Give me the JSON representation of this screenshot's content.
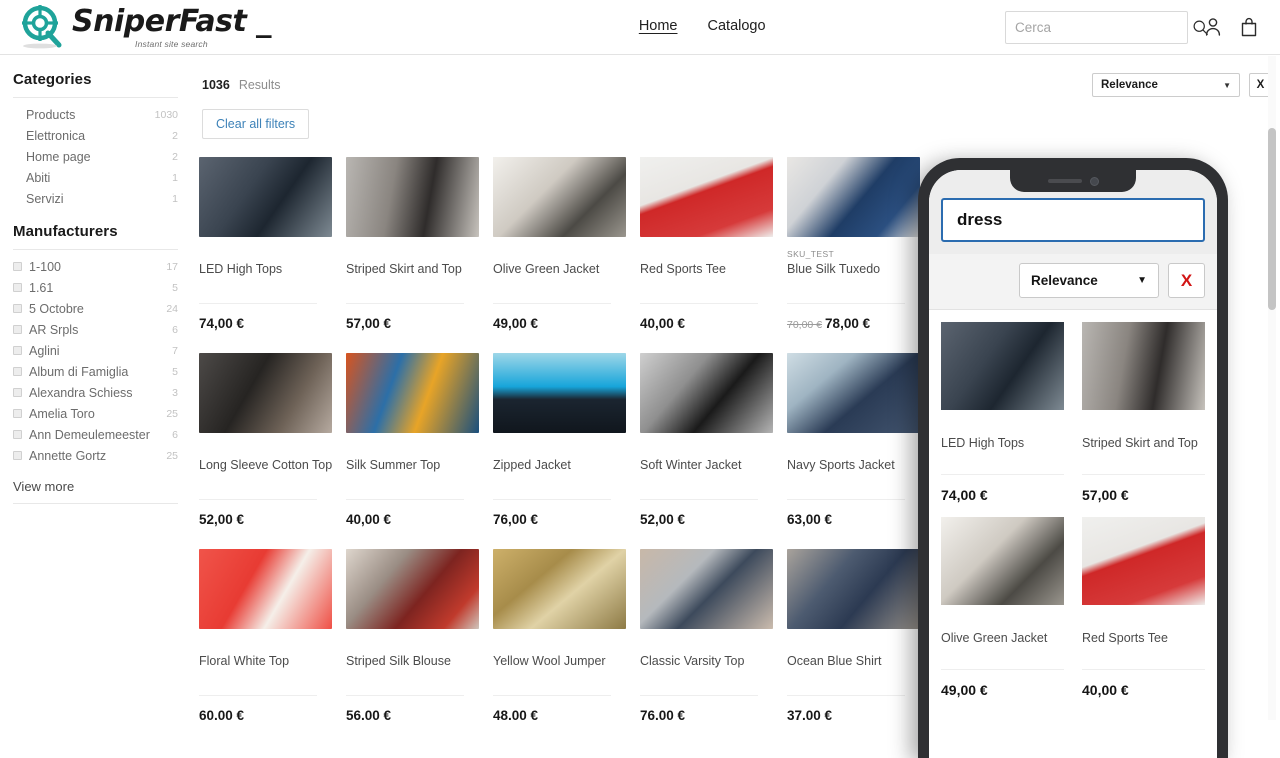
{
  "brand": {
    "name": "SniperFast _",
    "tagline": "Instant site search",
    "logo_color": "#1fa39a"
  },
  "header": {
    "nav": [
      {
        "label": "Home",
        "active": true
      },
      {
        "label": "Catalogo",
        "active": false
      }
    ],
    "search": {
      "value": "",
      "placeholder": "Cerca"
    },
    "icons": [
      "search-icon",
      "account-icon",
      "cart-icon"
    ]
  },
  "sidebar": {
    "categories_title": "Categories",
    "categories": [
      {
        "label": "Products",
        "count": "1030"
      },
      {
        "label": "Elettronica",
        "count": "2"
      },
      {
        "label": "Home page",
        "count": "2"
      },
      {
        "label": "Abiti",
        "count": "1"
      },
      {
        "label": "Servizi",
        "count": "1"
      }
    ],
    "manufacturers_title": "Manufacturers",
    "manufacturers": [
      {
        "label": "1-100",
        "count": "17"
      },
      {
        "label": "1.61",
        "count": "5"
      },
      {
        "label": "5 Octobre",
        "count": "24"
      },
      {
        "label": "AR Srpls",
        "count": "6"
      },
      {
        "label": "Aglini",
        "count": "7"
      },
      {
        "label": "Album di Famiglia",
        "count": "5"
      },
      {
        "label": "Alexandra Schiess",
        "count": "3"
      },
      {
        "label": "Amelia Toro",
        "count": "25"
      },
      {
        "label": "Ann Demeulemeester",
        "count": "6"
      },
      {
        "label": "Annette Gortz",
        "count": "25"
      }
    ],
    "view_more": "View more"
  },
  "main": {
    "results_count": "1036",
    "results_label": "Results",
    "clear_filters": "Clear all filters",
    "sort_value": "Relevance",
    "close_label": "X",
    "products": [
      {
        "sku": "",
        "name": "LED High Tops",
        "price": "74,00 €",
        "old_price": "",
        "art": "art-shoes"
      },
      {
        "sku": "",
        "name": "Striped Skirt and Top",
        "price": "57,00 €",
        "old_price": "",
        "art": "art-skirt"
      },
      {
        "sku": "",
        "name": "Olive Green Jacket",
        "price": "49,00 €",
        "old_price": "",
        "art": "art-olive"
      },
      {
        "sku": "",
        "name": "Red Sports Tee",
        "price": "40,00 €",
        "old_price": "",
        "art": "art-redtee"
      },
      {
        "sku": "SKU_TEST",
        "name": "Blue Silk Tuxedo",
        "price": "78,00 €",
        "old_price": "70,00 €",
        "art": "art-tuxedo"
      },
      {
        "sku": "",
        "name": "Long Sleeve Cotton Top",
        "price": "52,00 €",
        "old_price": "",
        "art": "art-longsleeve"
      },
      {
        "sku": "",
        "name": "Silk Summer Top",
        "price": "40,00 €",
        "old_price": "",
        "art": "art-silksummer"
      },
      {
        "sku": "",
        "name": "Zipped Jacket",
        "price": "76,00 €",
        "old_price": "",
        "art": "art-zipped"
      },
      {
        "sku": "",
        "name": "Soft Winter Jacket",
        "price": "52,00 €",
        "old_price": "",
        "art": "art-winter"
      },
      {
        "sku": "",
        "name": "Navy Sports Jacket",
        "price": "63,00 €",
        "old_price": "",
        "art": "art-navy"
      },
      {
        "sku": "",
        "name": "Floral White Top",
        "price": "60,00 €",
        "old_price": "",
        "art": "art-floral"
      },
      {
        "sku": "",
        "name": "Striped Silk Blouse",
        "price": "56,00 €",
        "old_price": "",
        "art": "art-blouse"
      },
      {
        "sku": "",
        "name": "Yellow Wool Jumper",
        "price": "48,00 €",
        "old_price": "",
        "art": "art-yellow"
      },
      {
        "sku": "",
        "name": "Classic Varsity Top",
        "price": "76,00 €",
        "old_price": "",
        "art": "art-varsity"
      },
      {
        "sku": "",
        "name": "Ocean Blue Shirt",
        "price": "37,00 €",
        "old_price": "",
        "art": "art-ocean"
      }
    ]
  },
  "phone": {
    "search_value": "dress",
    "sort_value": "Relevance",
    "close_label": "X",
    "products": [
      {
        "name": "LED High Tops",
        "price": "74,00 €",
        "art": "art-shoes"
      },
      {
        "name": "Striped Skirt and Top",
        "price": "57,00 €",
        "art": "art-skirt"
      },
      {
        "name": "Olive Green Jacket",
        "price": "49,00 €",
        "art": "art-olive"
      },
      {
        "name": "Red Sports Tee",
        "price": "40,00 €",
        "art": "art-redtee"
      }
    ]
  }
}
